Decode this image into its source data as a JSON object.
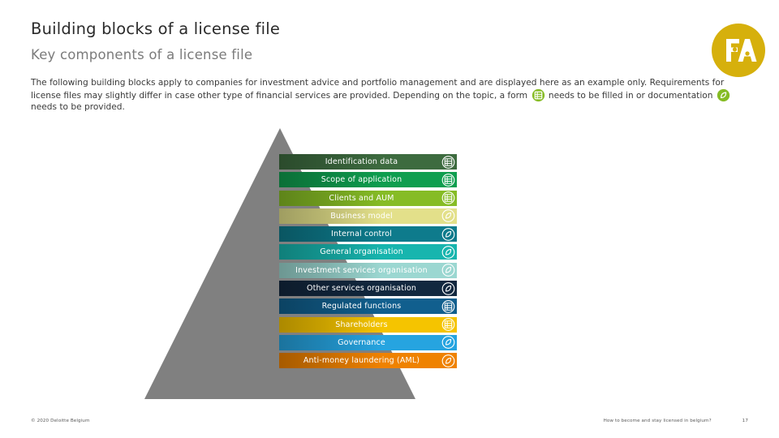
{
  "header": {
    "title": "Building blocks of a license file",
    "subtitle": "Key components of a license file",
    "logo_text": "FA"
  },
  "body": {
    "part1": "The following building blocks apply to companies for investment advice and portfolio management and are displayed here as an example only. Requirements for license files may slightly differ in case other type of financial services are provided. Depending on the topic, a form ",
    "part2": " needs to be filled in or documentation ",
    "part3": " needs to be provided.",
    "form_icon_name": "form-icon",
    "doc_icon_name": "document-icon"
  },
  "pyramid": {
    "triangle_color": "#808080",
    "bars": [
      {
        "label": "Identification data",
        "color": "#3d6b3f",
        "icon": "form-icon"
      },
      {
        "label": "Scope of application",
        "color": "#0f9e4f",
        "icon": "form-icon"
      },
      {
        "label": "Clients and AUM",
        "color": "#86bc25",
        "icon": "form-icon"
      },
      {
        "label": "Business model",
        "color": "#e3e08a",
        "icon": "document-icon"
      },
      {
        "label": "Internal control",
        "color": "#0e7b8c",
        "icon": "document-icon"
      },
      {
        "label": "General organisation",
        "color": "#17b5ae",
        "icon": "document-icon"
      },
      {
        "label": "Investment services organisation",
        "color": "#9bd7d1",
        "icon": "document-icon"
      },
      {
        "label": "Other services organisation",
        "color": "#12283f",
        "icon": "document-icon"
      },
      {
        "label": "Regulated functions",
        "color": "#115f8e",
        "icon": "form-icon"
      },
      {
        "label": "Shareholders",
        "color": "#f5c400",
        "icon": "form-icon"
      },
      {
        "label": "Governance",
        "color": "#26a4e0",
        "icon": "document-icon"
      },
      {
        "label": "Anti-money laundering (AML)",
        "color": "#ef8200",
        "icon": "document-icon"
      }
    ]
  },
  "footer": {
    "copyright": "© 2020 Deloitte Belgium",
    "deck_title": "How to become and stay licensed in belgium?",
    "page_number": "17"
  },
  "colors": {
    "logo_gold": "#d6b00c",
    "icon_green": "#86bc25",
    "title_text": "#2b2b2b",
    "subtitle_text": "#7b7b7b"
  }
}
